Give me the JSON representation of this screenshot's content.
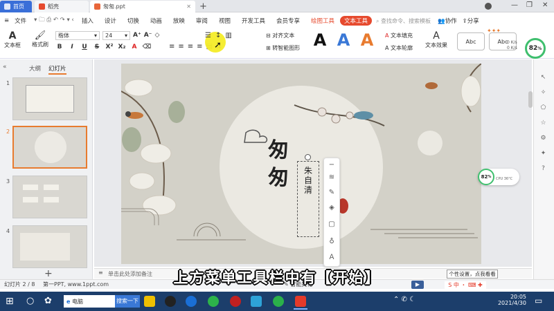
{
  "tabs": {
    "home": "首页",
    "daoke": "稻壳",
    "file": "匆匆.ppt",
    "add": "+"
  },
  "window": {
    "min": "—",
    "max": "❐",
    "close": "✕"
  },
  "menu": {
    "file_label": "文件",
    "items": [
      "插入",
      "设计",
      "切换",
      "动画",
      "放映",
      "审阅",
      "视图",
      "开发工具",
      "会员专享"
    ],
    "tool_drawing": "绘图工具",
    "tool_text": "文本工具",
    "search_placeholder": "查找命令、搜索模板",
    "collab": "协作",
    "share": "分享"
  },
  "ribbon": {
    "textbox": "文本框",
    "format_painter": "格式刷",
    "font_name": "楷体",
    "font_size": "24",
    "align_text": "对齐文本",
    "smartart": "转智能图形",
    "text_fill": "文本填充",
    "text_outline": "文本轮廓",
    "text_effect": "文本效果",
    "style_abc_1": "Abc",
    "style_abc_2": "Abc",
    "wordart_letter": "A"
  },
  "panel": {
    "tab_outline": "大纲",
    "tab_slides": "幻灯片",
    "nums": [
      "1",
      "2",
      "3",
      "4"
    ],
    "add": "+"
  },
  "slide": {
    "title_char1": "匆",
    "title_char2": "匆",
    "author": "朱自清"
  },
  "notes": {
    "placeholder": "单击此处添加备注"
  },
  "status": {
    "slide_info": "幻灯片 2 / 8",
    "theme": "第一PPT, www.1ppt.com",
    "beautify": "智能美化"
  },
  "tooltip": "个性设置，点我看看",
  "caption": "上方菜单工具栏中有【开始】",
  "gauge": {
    "top_value": "82",
    "top_unit": "%",
    "mid_value": "82",
    "mid_unit": "%",
    "net_up": "0 K/s",
    "net_down": "0 K/s",
    "cpu": "CPU 36°C"
  },
  "taskbar": {
    "search_text": "电脑",
    "search_button": "搜索一下",
    "time": "20:05",
    "date": "2021/4/30"
  },
  "colors": {
    "accent": "#e87b2f",
    "tab_blue": "#3a6fd8",
    "tool_red": "#e64a2e",
    "taskbar": "#1c3e6b"
  }
}
